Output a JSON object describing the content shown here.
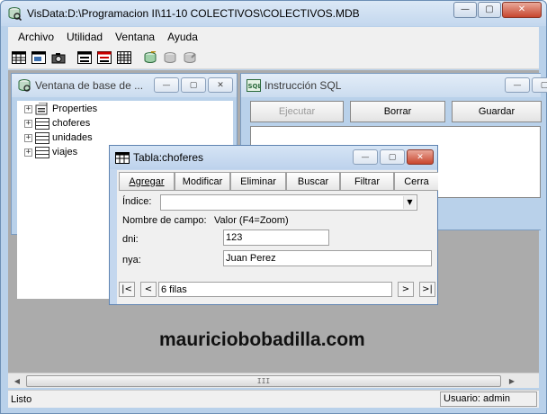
{
  "window": {
    "title": "VisData:D:\\Programacion II\\11-10 COLECTIVOS\\COLECTIVOS.MDB",
    "minimize_glyph": "—",
    "maximize_glyph": "▢",
    "close_glyph": "✕"
  },
  "menu": {
    "items": [
      {
        "label": "Archivo"
      },
      {
        "label": "Utilidad"
      },
      {
        "label": "Ventana"
      },
      {
        "label": "Ayuda"
      }
    ]
  },
  "toolbar": {
    "icons": [
      "table-view-icon",
      "dynaset-icon",
      "snapshot-icon",
      "form-icon",
      "data-control-icon",
      "grid-icon",
      "begin-transaction-icon",
      "commit-icon",
      "rollback-icon"
    ]
  },
  "db_window": {
    "title": "Ventana de base de ...",
    "tree": [
      {
        "label": "Properties",
        "icon": "properties-icon"
      },
      {
        "label": "choferes",
        "icon": "table-icon"
      },
      {
        "label": "unidades",
        "icon": "table-icon"
      },
      {
        "label": "viajes",
        "icon": "table-icon"
      }
    ],
    "expander": "+"
  },
  "sql_window": {
    "title": "Instrucción SQL",
    "execute_label": "Ejecutar",
    "clear_label": "Borrar",
    "save_label": "Guardar"
  },
  "table_window": {
    "title": "Tabla:choferes",
    "buttons": [
      {
        "label": "Agregar"
      },
      {
        "label": "Modificar"
      },
      {
        "label": "Eliminar"
      },
      {
        "label": "Buscar"
      },
      {
        "label": "Filtrar"
      },
      {
        "label": "Cerra"
      }
    ],
    "index_label": "Índice:",
    "index_value": "",
    "field_name_header": "Nombre de campo:",
    "value_header": "Valor (F4=Zoom)",
    "fields": [
      {
        "name": "dni:",
        "value": "123"
      },
      {
        "name": "nya:",
        "value": "Juan Perez"
      }
    ],
    "nav": {
      "first": "|<",
      "prev": "<",
      "record_text": "6 filas",
      "next": ">",
      "last": ">|"
    }
  },
  "watermark": "mauriciobobadilla.com",
  "status": {
    "left": "Listo",
    "right": "Usuario: admin"
  },
  "scrollbar": {
    "left_arrow": "◀",
    "right_arrow": "▶",
    "grip": "III"
  }
}
